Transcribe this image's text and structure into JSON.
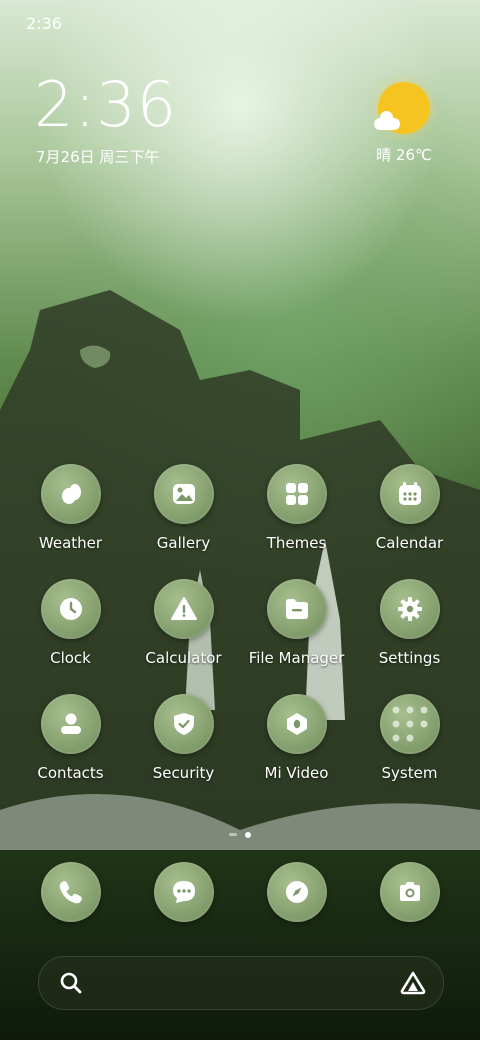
{
  "status_bar": {
    "time": "2:36"
  },
  "clock_widget": {
    "time": "2:36",
    "date": "7月26日 周三下午"
  },
  "weather_widget": {
    "condition_icon": "sun-cloud-icon",
    "text": "晴 26℃"
  },
  "home_grid": {
    "rows": [
      [
        {
          "label": "Weather",
          "icon": "weather-icon"
        },
        {
          "label": "Gallery",
          "icon": "gallery-icon"
        },
        {
          "label": "Themes",
          "icon": "themes-icon"
        },
        {
          "label": "Calendar",
          "icon": "calendar-icon"
        }
      ],
      [
        {
          "label": "Clock",
          "icon": "clock-icon"
        },
        {
          "label": "Calculator",
          "icon": "calculator-icon"
        },
        {
          "label": "File Manager",
          "icon": "file-manager-icon"
        },
        {
          "label": "Settings",
          "icon": "settings-icon"
        }
      ],
      [
        {
          "label": "Contacts",
          "icon": "contacts-icon"
        },
        {
          "label": "Security",
          "icon": "security-icon"
        },
        {
          "label": "Mi Video",
          "icon": "mi-video-icon"
        },
        {
          "label": "System",
          "icon": "system-folder-icon"
        }
      ]
    ]
  },
  "page_indicator": {
    "pages": 2,
    "current": 2
  },
  "dock": [
    {
      "icon": "phone-icon"
    },
    {
      "icon": "messages-icon"
    },
    {
      "icon": "browser-compass-icon"
    },
    {
      "icon": "camera-icon"
    }
  ],
  "search_bar": {
    "left_icon": "search-icon",
    "right_icon": "app-vault-icon"
  }
}
